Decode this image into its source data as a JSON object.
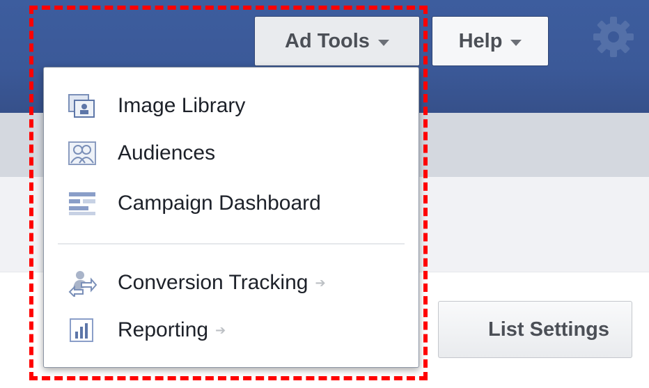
{
  "header": {
    "ad_tools_label": "Ad Tools",
    "help_label": "Help",
    "settings_icon": "gear-icon"
  },
  "toolbar": {
    "list_settings_label": "List Settings"
  },
  "ad_tools_menu": {
    "items": [
      {
        "label": "Image Library",
        "icon": "image-library-icon",
        "has_submenu": false
      },
      {
        "label": "Audiences",
        "icon": "audiences-icon",
        "has_submenu": false
      },
      {
        "label": "Campaign Dashboard",
        "icon": "dashboard-icon",
        "has_submenu": false
      },
      {
        "label": "Conversion Tracking",
        "icon": "conversion-tracking-icon",
        "has_submenu": true
      },
      {
        "label": "Reporting",
        "icon": "reporting-icon",
        "has_submenu": true
      }
    ]
  },
  "colors": {
    "topbar": "#3b5998",
    "highlight_border": "#ff0000",
    "text": "#1d2129"
  }
}
